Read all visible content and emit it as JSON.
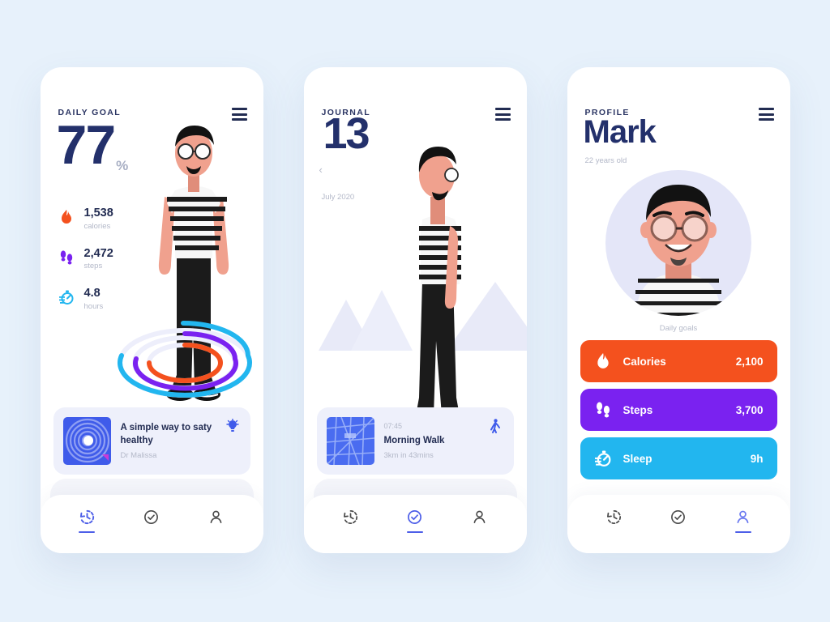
{
  "background_color": "#e7f1fb",
  "theme": {
    "navy": "#23306b",
    "accent_blue": "#4e5fe8",
    "orange": "#f4511e",
    "purple": "#7a22f0",
    "cyan": "#22b6ef",
    "muted": "#b3b8c8"
  },
  "screens": [
    {
      "id": "daily-goal",
      "kicker": "DAILY GOAL",
      "menu_icon": "hamburger-menu-icon",
      "percent_value": "77",
      "percent_symbol": "%",
      "stats": [
        {
          "icon": "flame-icon",
          "value": "1,538",
          "label": "calories",
          "color": "#f4511e"
        },
        {
          "icon": "footsteps-icon",
          "value": "2,472",
          "label": "steps",
          "color": "#7a22f0"
        },
        {
          "icon": "stopwatch-icon",
          "value": "4.8",
          "label": "hours",
          "color": "#22b6ef"
        }
      ],
      "card": {
        "thumbnail": "ripple-artwork-thumbnail",
        "title": "A simple way to saty healthy",
        "subtitle": "Dr Malissa",
        "action_icon": "lightbulb-icon"
      },
      "nav": [
        {
          "icon": "history-clock-icon",
          "active": true
        },
        {
          "icon": "check-circle-icon",
          "active": false
        },
        {
          "icon": "person-icon",
          "active": false
        }
      ]
    },
    {
      "id": "journal",
      "kicker": "JOURNAL",
      "menu_icon": "hamburger-menu-icon",
      "day": "13",
      "prev_icon": "chevron-left-icon",
      "month": "July 2020",
      "card": {
        "thumbnail": "map-thumbnail",
        "time": "07:45",
        "title": "Morning Walk",
        "subtitle": "3km in 43mins",
        "action_icon": "walking-person-icon"
      },
      "nav": [
        {
          "icon": "history-clock-icon",
          "active": false
        },
        {
          "icon": "check-circle-icon",
          "active": true
        },
        {
          "icon": "person-icon",
          "active": false
        }
      ]
    },
    {
      "id": "profile",
      "kicker": "PROFILE",
      "menu_icon": "hamburger-menu-icon",
      "name": "Mark",
      "age": "22 years old",
      "avatar": "user-avatar",
      "goals_label": "Daily goals",
      "goals": [
        {
          "icon": "flame-icon",
          "label": "Calories",
          "value": "2,100",
          "color": "#f4511e"
        },
        {
          "icon": "footsteps-icon",
          "label": "Steps",
          "value": "3,700",
          "color": "#7a22f0"
        },
        {
          "icon": "stopwatch-icon",
          "label": "Sleep",
          "value": "9h",
          "color": "#22b6ef"
        }
      ],
      "nav": [
        {
          "icon": "history-clock-icon",
          "active": false
        },
        {
          "icon": "check-circle-icon",
          "active": false
        },
        {
          "icon": "person-icon",
          "active": true
        }
      ]
    }
  ]
}
